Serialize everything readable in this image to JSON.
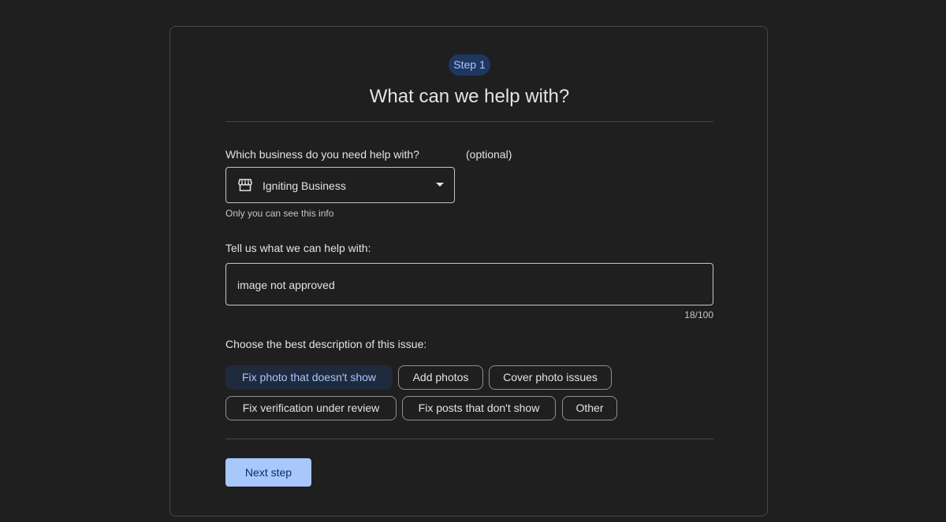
{
  "step": {
    "label": "Step 1"
  },
  "title": "What can we help with?",
  "business": {
    "label": "Which business do you need help with?",
    "optional": "(optional)",
    "selected": "Igniting Business",
    "helper": "Only you can see this info"
  },
  "description": {
    "label": "Tell us what we can help with:",
    "value": "image not approved",
    "counter": "18/100"
  },
  "issues": {
    "label": "Choose the best description of this issue:",
    "options": [
      {
        "label": "Fix photo that doesn't show",
        "selected": true
      },
      {
        "label": "Add photos",
        "selected": false
      },
      {
        "label": "Cover photo issues",
        "selected": false
      },
      {
        "label": "Fix verification under review",
        "selected": false
      },
      {
        "label": "Fix posts that don't show",
        "selected": false
      },
      {
        "label": "Other",
        "selected": false
      }
    ]
  },
  "actions": {
    "next_label": "Next step"
  },
  "colors": {
    "background": "#1f1f1f",
    "accent": "#a8c7fa",
    "chip_selected_bg": "#1f2a3d",
    "step_chip_bg": "#1f3760"
  }
}
